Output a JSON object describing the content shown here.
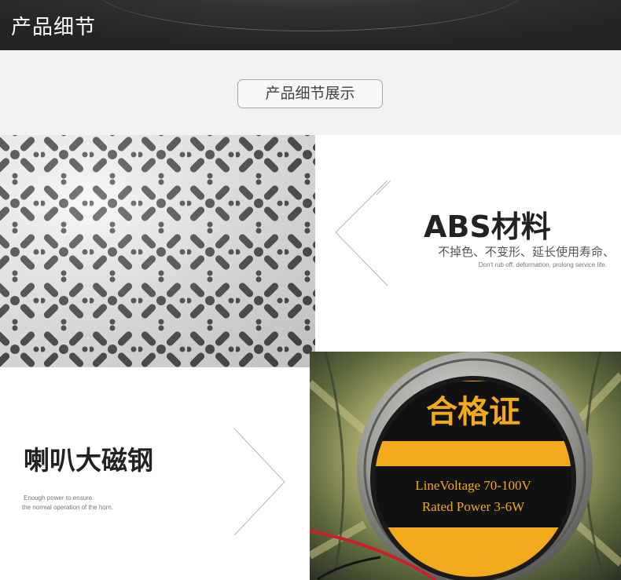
{
  "header": {
    "title": "产品细节"
  },
  "banner": {
    "label": "产品细节展示"
  },
  "abs_section": {
    "title": "ABS材料",
    "subtitle": "不掉色、不变形、延长使用寿命、",
    "subtitle_en": "Don't rub off, deformation, prolong service life."
  },
  "magnet_section": {
    "title": "喇叭大磁钢",
    "desc_en_line1": "Enough power to ensure",
    "desc_en_line2": "the normal operation of the horn."
  },
  "speaker_label": {
    "title": "合格证",
    "line1": "LineVoltage 70-100V",
    "line2": "Rated Power 3-6W"
  },
  "colors": {
    "header_bg": "#2b2b2b",
    "banner_bg": "#f2f2f2",
    "label_yellow": "#f2a91c",
    "label_black": "#111111",
    "pattern_white": "#f3f3f3",
    "pattern_holes": "#3a3a3a"
  }
}
